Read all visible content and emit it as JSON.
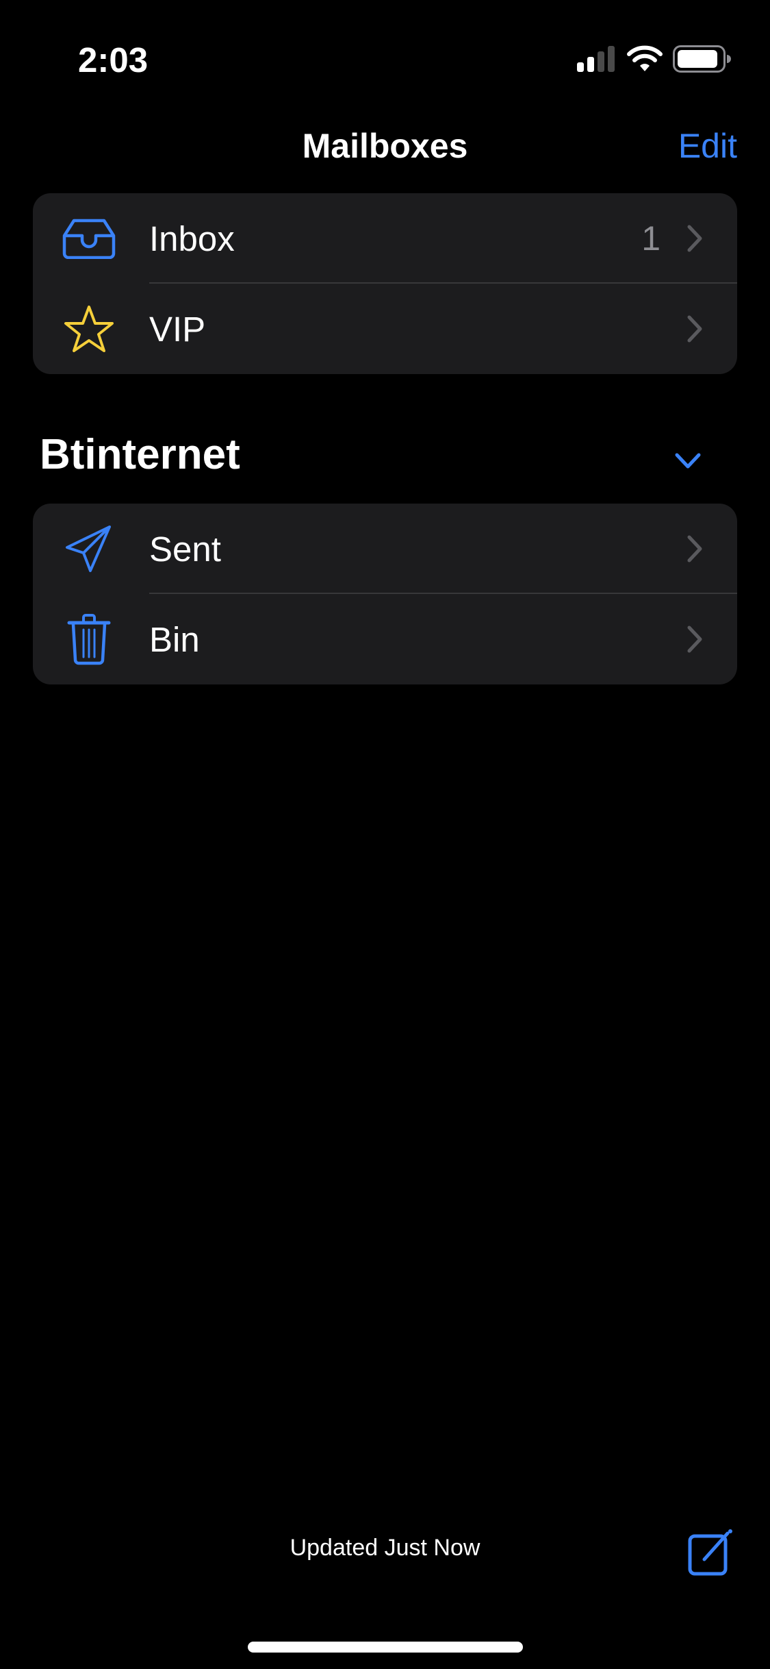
{
  "status_bar": {
    "time": "2:03",
    "signal_icon": "cellular-signal-icon",
    "wifi_icon": "wifi-icon",
    "battery_icon": "battery-icon"
  },
  "nav": {
    "title": "Mailboxes",
    "edit_label": "Edit"
  },
  "colors": {
    "accent": "#3a82f7",
    "vip_star": "#f5cf3a",
    "group_bg": "#1c1c1e",
    "secondary_text": "#8e8e93"
  },
  "top_mailboxes": [
    {
      "label": "Inbox",
      "icon": "inbox-tray-icon",
      "count": "1"
    },
    {
      "label": "VIP",
      "icon": "star-icon",
      "count": ""
    }
  ],
  "account": {
    "name": "Btinternet",
    "toggle_icon": "chevron-down-icon",
    "mailboxes": [
      {
        "label": "Sent",
        "icon": "paper-plane-icon"
      },
      {
        "label": "Bin",
        "icon": "trash-icon"
      }
    ]
  },
  "footer": {
    "status": "Updated Just Now",
    "compose_icon": "compose-icon"
  }
}
